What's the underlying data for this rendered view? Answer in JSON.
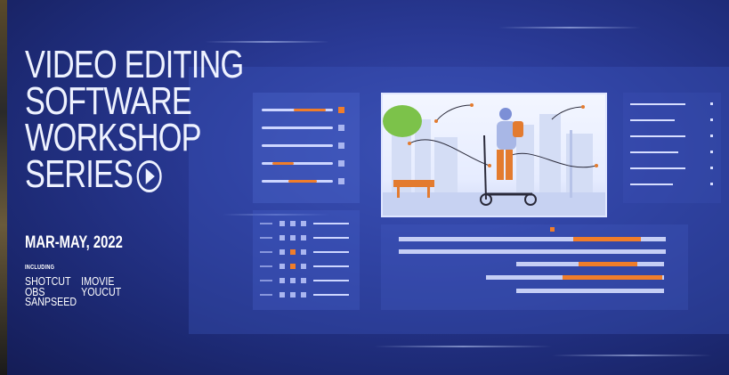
{
  "banner": {
    "title_lines": [
      "VIDEO EDITING",
      "SOFTWARE",
      "WORKSHOP",
      "SERIES"
    ],
    "dates": "MAR-MAY, 2022",
    "includes_label": "INCLUDING",
    "tools_col1": [
      "SHOTCUT",
      "OBS",
      "SANPSEED"
    ],
    "tools_col2": [
      "IMOVIE",
      "YOUCUT"
    ]
  },
  "colors": {
    "background": "#2a3a96",
    "accent": "#f07d2a",
    "text": "#eef2ff"
  },
  "icons": {
    "play": "play-circle-icon"
  },
  "editor": {
    "sliders": [
      0.45,
      0.0,
      0.0,
      0.3,
      0.4
    ],
    "timeline_bars": [
      {
        "orange_start": 0.65,
        "orange_end": 0.9
      },
      {
        "orange_start": 0.0,
        "orange_end": 0.0
      },
      {
        "orange_start": 0.43,
        "orange_end": 0.8
      },
      {
        "orange_start": 0.43,
        "orange_end": 0.98
      },
      {
        "orange_start": 0.0,
        "orange_end": 0.0
      }
    ]
  }
}
